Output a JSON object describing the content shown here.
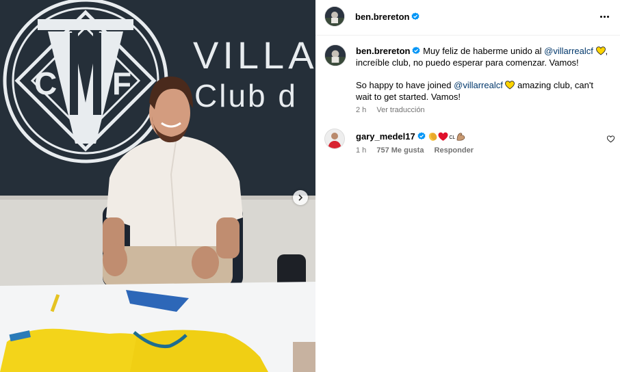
{
  "post": {
    "image_alt": "Photo of a man seated at a table in front of the Villarreal CF crest",
    "wall_text": {
      "line1": "VILLA",
      "line2": "Club d"
    },
    "crest_letters": {
      "c": "C",
      "f": "F"
    }
  },
  "header": {
    "username": "ben.brereton",
    "verified_icon": "verified-badge-icon",
    "more_icon": "more-options-icon"
  },
  "caption": {
    "username": "ben.brereton",
    "es_part1": "Muy feliz de haberme unido al",
    "es_mention": "@villarrealcf",
    "es_part2": ", increíble club, no puedo esperar para comenzar. Vamos!",
    "en_part1": "So happy to have joined",
    "en_mention": "@villarrealcf",
    "en_part2": "amazing club, can't wait to get started. Vamos!",
    "time": "2 h",
    "translate": "Ver traducción",
    "heart_icon": "yellow-heart-icon"
  },
  "comment": {
    "username": "gary_medel17",
    "emoji_text": "CL",
    "emoji_icons": [
      "clapping-hands-icon",
      "red-heart-icon",
      "chile-flag-icon",
      "flexed-biceps-icon"
    ],
    "time": "1 h",
    "likes": "757 Me gusta",
    "reply": "Responder",
    "like_icon": "heart-outline-icon"
  },
  "colors": {
    "verified_blue": "#0095f6",
    "mention_blue": "#00376b",
    "meta_gray": "#737373",
    "yellow_heart": "#ffd400",
    "red_heart": "#e0102b"
  }
}
